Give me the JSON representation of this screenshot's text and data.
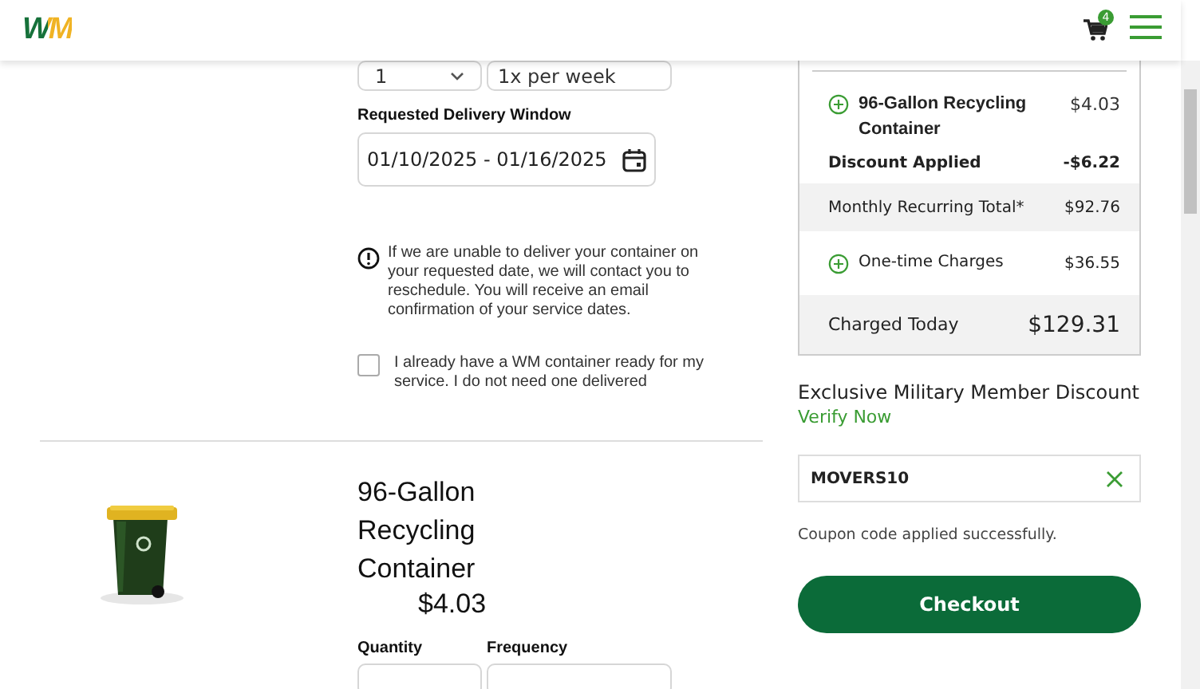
{
  "header": {
    "logo": "WM",
    "cart_count": "4"
  },
  "service_fields": [
    {
      "value": "1",
      "kind": "select"
    },
    {
      "value": "1x per week",
      "kind": "text"
    }
  ],
  "delivery_window": {
    "label": "Requested Delivery Window",
    "value": "01/10/2025 - 01/16/2025"
  },
  "notice": "If we are unable to deliver your container on your requested date, we will contact you to reschedule. You will receive an email confirmation of your service dates.",
  "own_container": {
    "label": "I already have a WM container ready for my service. I do not need one delivered",
    "checked": false
  },
  "product": {
    "title": "96-Gallon Recycling Container",
    "price": "$4.03",
    "field_labels": [
      "Quantity",
      "Frequency"
    ]
  },
  "summary": {
    "rows": [
      {
        "kind": "item",
        "label": "96-Gallon Recycling Container",
        "amount": "$4.03"
      },
      {
        "kind": "discount",
        "label": "Discount Applied",
        "amount": "-$6.22"
      },
      {
        "kind": "subtotal",
        "label": "Monthly Recurring Total*",
        "amount": "$92.76"
      },
      {
        "kind": "expandable",
        "label": "One-time Charges",
        "amount": "$36.55"
      },
      {
        "kind": "total",
        "label": "Charged Today",
        "amount": "$129.31"
      }
    ]
  },
  "military_discount": {
    "title": "Exclusive Military Member Discount",
    "link": "Verify Now"
  },
  "coupon": {
    "value": "MOVERS10",
    "message": "Coupon code applied successfully."
  },
  "checkout_button": "Checkout"
}
